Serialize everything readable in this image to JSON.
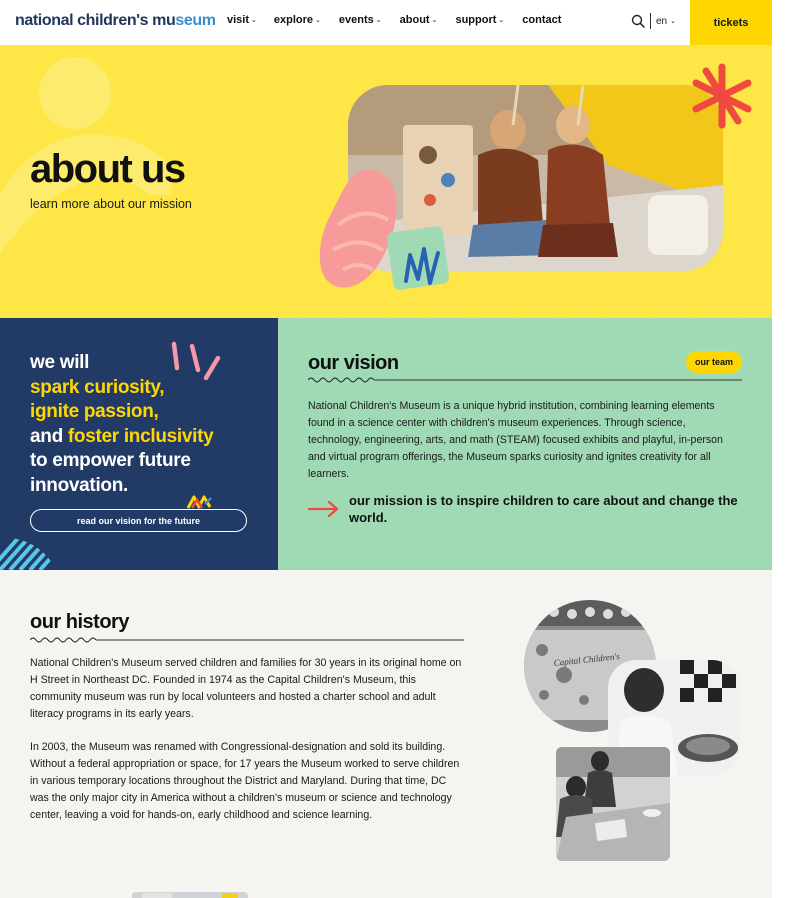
{
  "header": {
    "logo_text": "national children's mu",
    "logo_accent": "seum",
    "nav": [
      {
        "label": "visit",
        "has_dropdown": true
      },
      {
        "label": "explore",
        "has_dropdown": true
      },
      {
        "label": "events",
        "has_dropdown": true
      },
      {
        "label": "about",
        "has_dropdown": true
      },
      {
        "label": "support",
        "has_dropdown": true
      },
      {
        "label": "contact",
        "has_dropdown": false
      }
    ],
    "search_icon": "search-icon",
    "language": "en",
    "tickets_label": "tickets"
  },
  "hero": {
    "title": "about us",
    "subtitle": "learn more about our mission"
  },
  "pledge": {
    "line1": "we will",
    "line2": "spark curiosity,",
    "line3": "ignite passion,",
    "line4a": "and ",
    "line4b": "foster inclusivity",
    "line5": "to empower future",
    "line6": "innovation.",
    "button_label": "read our vision for the future"
  },
  "vision": {
    "title": "our vision",
    "team_label": "our team",
    "body": "National Children's Museum is a unique hybrid institution, combining learning elements found in a science center with children's museum experiences. Through science, technology, engineering, arts, and math (STEAM) focused exhibits and playful, in-person and virtual program offerings, the Museum sparks curiosity and ignites creativity for all learners.",
    "mission": "our mission is to inspire children to care about and change the world."
  },
  "history": {
    "title": "our history",
    "paragraphs": [
      "National Children's Museum served children and families for 30 years in its original home on H Street in Northeast DC. Founded in 1974 as the Capital Children's Museum, this community museum was run by local volunteers and hosted a charter school and adult literacy programs in its early years.",
      "In 2003, the Museum was renamed with Congressional-designation and sold its building. Without a federal appropriation or space, for 17 years the Museum worked to serve children in various temporary locations throughout the District and Maryland. During that time, DC was the only major city in America without a children's museum or science and technology center, leaving a void for hands-on, early childhood and science learning."
    ],
    "mural_text": "Capital Children's"
  },
  "colors": {
    "yellow": "#fed702",
    "hero_yellow": "#fde645",
    "navy": "#223a66",
    "mint": "#9fdab4",
    "coral": "#ef5a45",
    "cream": "#f5f4f0"
  }
}
